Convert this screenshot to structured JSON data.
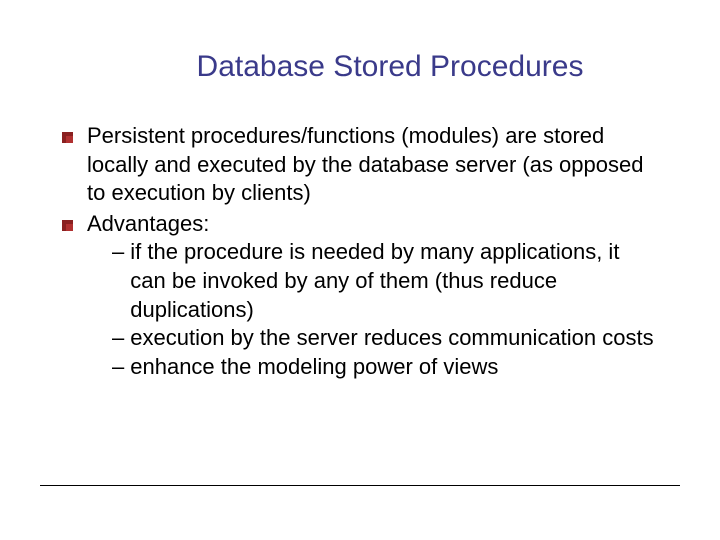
{
  "title": "Database Stored Procedures",
  "bullets": {
    "b1": "Persistent procedures/functions (modules) are stored locally and executed by the database server (as opposed to execution by clients)",
    "b2": "Advantages:",
    "s1": "if the procedure is needed by many applications, it can be invoked by any of them (thus reduce duplications)",
    "s2": "execution by the server reduces communication costs",
    "s3": "enhance the modeling power of views"
  }
}
